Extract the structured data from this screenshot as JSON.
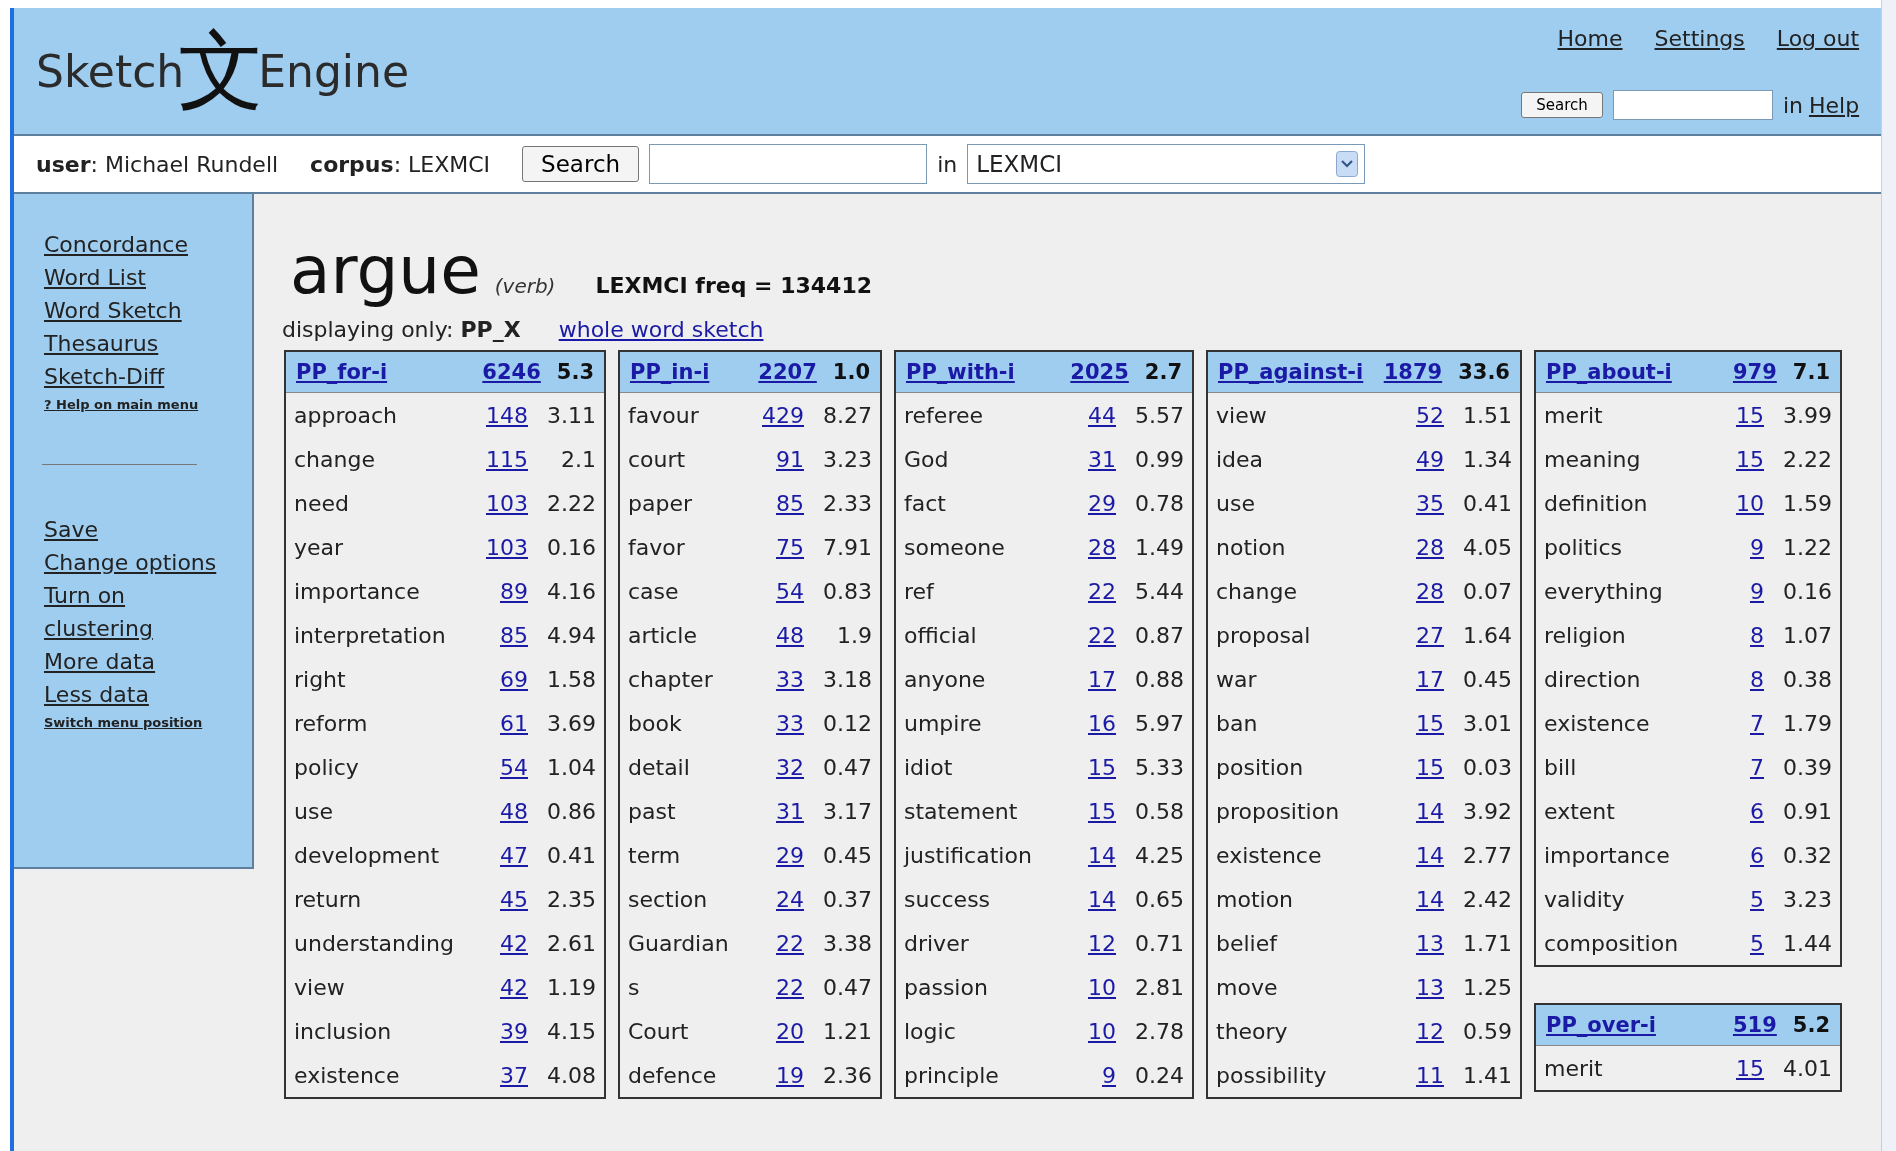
{
  "logo": {
    "left": "Sketch",
    "mark": "文",
    "right": "Engine"
  },
  "top_nav": [
    "Home",
    "Settings",
    "Log out"
  ],
  "help_search": {
    "button": "Search",
    "in": "in",
    "link": "Help"
  },
  "user_bar": {
    "user": "**user**: Michael Rundell",
    "corpus": "**corpus**: LEXMCI",
    "button": "Search",
    "in": "in",
    "corpus_select": "LEXMCI"
  },
  "sidebar": {
    "main": [
      "Concordance",
      "Word List",
      "Word Sketch",
      "Thesaurus",
      "Sketch-Diff"
    ],
    "help": "? Help on main menu",
    "options": [
      "Save",
      "Change options",
      "Turn on",
      "clustering",
      "More data",
      "Less data"
    ],
    "switch": "Switch menu position"
  },
  "headword": {
    "word": "argue",
    "pos": "(verb)",
    "freq": "LEXMCI freq = 134412"
  },
  "filter": {
    "text": "displaying only: **PP_X**",
    "link": "whole word sketch"
  },
  "columns": [
    [
      {
        "name": "PP_for-i",
        "count": "6246",
        "score": "5.3",
        "rows": [
          [
            "approach",
            "148",
            "3.11"
          ],
          [
            "change",
            "115",
            "2.1"
          ],
          [
            "need",
            "103",
            "2.22"
          ],
          [
            "year",
            "103",
            "0.16"
          ],
          [
            "importance",
            "89",
            "4.16"
          ],
          [
            "interpretation",
            "85",
            "4.94"
          ],
          [
            "right",
            "69",
            "1.58"
          ],
          [
            "reform",
            "61",
            "3.69"
          ],
          [
            "policy",
            "54",
            "1.04"
          ],
          [
            "use",
            "48",
            "0.86"
          ],
          [
            "development",
            "47",
            "0.41"
          ],
          [
            "return",
            "45",
            "2.35"
          ],
          [
            "understanding",
            "42",
            "2.61"
          ],
          [
            "view",
            "42",
            "1.19"
          ],
          [
            "inclusion",
            "39",
            "4.15"
          ],
          [
            "existence",
            "37",
            "4.08"
          ]
        ]
      }
    ],
    [
      {
        "name": "PP_in-i",
        "count": "2207",
        "score": "1.0",
        "rows": [
          [
            "favour",
            "429",
            "8.27"
          ],
          [
            "court",
            "91",
            "3.23"
          ],
          [
            "paper",
            "85",
            "2.33"
          ],
          [
            "favor",
            "75",
            "7.91"
          ],
          [
            "case",
            "54",
            "0.83"
          ],
          [
            "article",
            "48",
            "1.9"
          ],
          [
            "chapter",
            "33",
            "3.18"
          ],
          [
            "book",
            "33",
            "0.12"
          ],
          [
            "detail",
            "32",
            "0.47"
          ],
          [
            "past",
            "31",
            "3.17"
          ],
          [
            "term",
            "29",
            "0.45"
          ],
          [
            "section",
            "24",
            "0.37"
          ],
          [
            "Guardian",
            "22",
            "3.38"
          ],
          [
            "s",
            "22",
            "0.47"
          ],
          [
            "Court",
            "20",
            "1.21"
          ],
          [
            "defence",
            "19",
            "2.36"
          ]
        ]
      }
    ],
    [
      {
        "name": "PP_with-i",
        "count": "2025",
        "score": "2.7",
        "rows": [
          [
            "referee",
            "44",
            "5.57"
          ],
          [
            "God",
            "31",
            "0.99"
          ],
          [
            "fact",
            "29",
            "0.78"
          ],
          [
            "someone",
            "28",
            "1.49"
          ],
          [
            "ref",
            "22",
            "5.44"
          ],
          [
            "official",
            "22",
            "0.87"
          ],
          [
            "anyone",
            "17",
            "0.88"
          ],
          [
            "umpire",
            "16",
            "5.97"
          ],
          [
            "idiot",
            "15",
            "5.33"
          ],
          [
            "statement",
            "15",
            "0.58"
          ],
          [
            "justification",
            "14",
            "4.25"
          ],
          [
            "success",
            "14",
            "0.65"
          ],
          [
            "driver",
            "12",
            "0.71"
          ],
          [
            "passion",
            "10",
            "2.81"
          ],
          [
            "logic",
            "10",
            "2.78"
          ],
          [
            "principle",
            "9",
            "0.24"
          ]
        ]
      }
    ],
    [
      {
        "name": "PP_against-i",
        "count": "1879",
        "score": "33.6",
        "rows": [
          [
            "view",
            "52",
            "1.51"
          ],
          [
            "idea",
            "49",
            "1.34"
          ],
          [
            "use",
            "35",
            "0.41"
          ],
          [
            "notion",
            "28",
            "4.05"
          ],
          [
            "change",
            "28",
            "0.07"
          ],
          [
            "proposal",
            "27",
            "1.64"
          ],
          [
            "war",
            "17",
            "0.45"
          ],
          [
            "ban",
            "15",
            "3.01"
          ],
          [
            "position",
            "15",
            "0.03"
          ],
          [
            "proposition",
            "14",
            "3.92"
          ],
          [
            "existence",
            "14",
            "2.77"
          ],
          [
            "motion",
            "14",
            "2.42"
          ],
          [
            "belief",
            "13",
            "1.71"
          ],
          [
            "move",
            "13",
            "1.25"
          ],
          [
            "theory",
            "12",
            "0.59"
          ],
          [
            "possibility",
            "11",
            "1.41"
          ]
        ]
      }
    ],
    [
      {
        "name": "PP_about-i",
        "count": "979",
        "score": "7.1",
        "rows": [
          [
            "merit",
            "15",
            "3.99"
          ],
          [
            "meaning",
            "15",
            "2.22"
          ],
          [
            "definition",
            "10",
            "1.59"
          ],
          [
            "politics",
            "9",
            "1.22"
          ],
          [
            "everything",
            "9",
            "0.16"
          ],
          [
            "religion",
            "8",
            "1.07"
          ],
          [
            "direction",
            "8",
            "0.38"
          ],
          [
            "existence",
            "7",
            "1.79"
          ],
          [
            "bill",
            "7",
            "0.39"
          ],
          [
            "extent",
            "6",
            "0.91"
          ],
          [
            "importance",
            "6",
            "0.32"
          ],
          [
            "validity",
            "5",
            "3.23"
          ],
          [
            "composition",
            "5",
            "1.44"
          ]
        ]
      },
      {
        "name": "PP_over-i",
        "count": "519",
        "score": "5.2",
        "rows": [
          [
            "merit",
            "15",
            "4.01"
          ]
        ]
      }
    ]
  ]
}
